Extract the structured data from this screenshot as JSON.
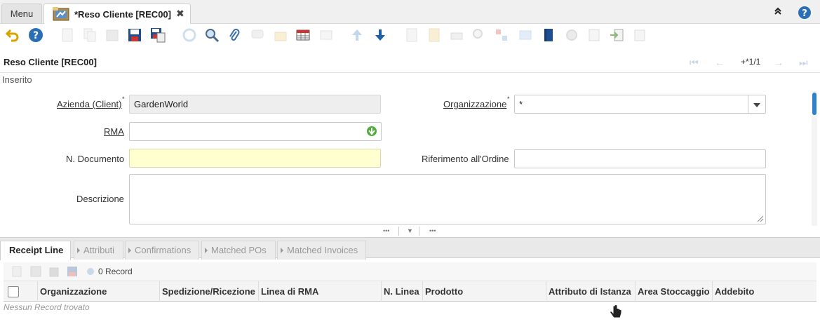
{
  "tabs": {
    "menu_label": "Menu",
    "window_label": "*Reso Cliente [REC00]",
    "close_glyph": "✖"
  },
  "header": {
    "collapse_glyph": "⌃",
    "help_glyph": "?"
  },
  "toolbar": {
    "icons": [
      "undo-icon",
      "help-icon",
      "new-icon",
      "copy-icon",
      "delete-icon",
      "save-icon",
      "save-new-icon",
      "refresh-icon",
      "find-icon",
      "attachment-icon",
      "chat-icon",
      "archive-icon",
      "grid-toggle-icon",
      "parent-icon",
      "previous-record-icon",
      "next-record-icon",
      "report-icon",
      "print-preview-icon",
      "print-icon",
      "zoom-icon",
      "product-info-icon",
      "request-icon",
      "history-icon",
      "workflow-icon",
      "process-icon",
      "export-icon",
      "import-icon",
      "customize-icon"
    ]
  },
  "record": {
    "title": "Reso Cliente [REC00]",
    "count": "+*1/1",
    "status": "Inserito"
  },
  "form": {
    "client_label": "Azienda (Client)",
    "client_value": "GardenWorld",
    "org_label": "Organizzazione",
    "org_value": "*",
    "rma_label": "RMA",
    "rma_value": "",
    "doc_no_label": "N. Documento",
    "doc_no_value": "",
    "order_ref_label": "Riferimento all'Ordine",
    "order_ref_value": "",
    "description_label": "Descrizione",
    "description_value": "",
    "required_mark": "*"
  },
  "subtabs": {
    "items": [
      "Receipt Line",
      "Attributi",
      "Confirmations",
      "Matched POs",
      "Matched Invoices"
    ]
  },
  "detail": {
    "record_count": "0 Record",
    "columns": [
      "Organizzazione",
      "Spedizione/Ricezione",
      "Linea di RMA",
      "N. Linea",
      "Prodotto",
      "Attributo di Istanza",
      "Area Stoccaggio",
      "Addebito"
    ],
    "empty_text": "Nessun Record trovato"
  },
  "colors": {
    "accent": "#1f5fa6",
    "mandatory_bg": "#ffffd0",
    "readonly_bg": "#eeeeee"
  }
}
